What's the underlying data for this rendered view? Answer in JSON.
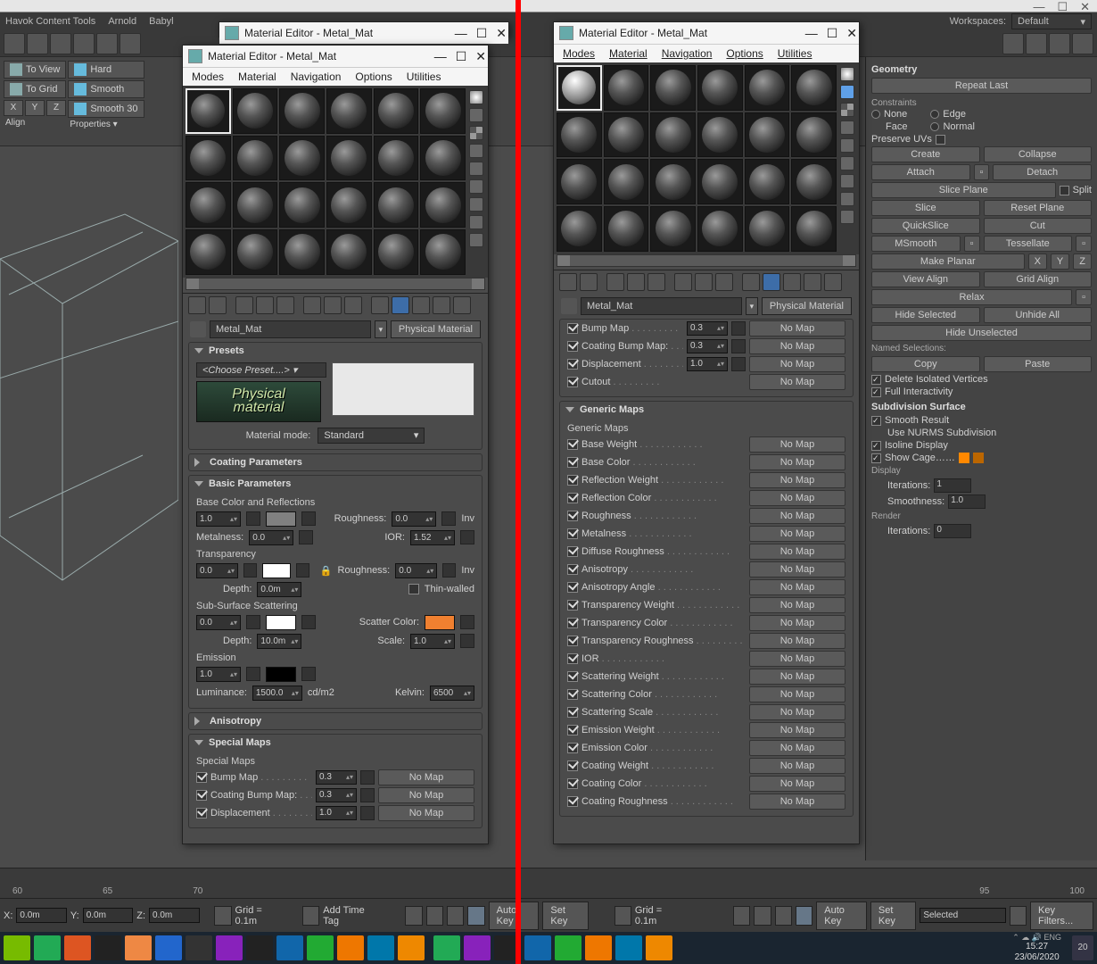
{
  "app": {
    "titlebar_ctrls": [
      "—",
      "☐",
      "✕"
    ]
  },
  "topmenu": {
    "left": [
      "Havok Content Tools",
      "Arnold",
      "Babyl"
    ],
    "right_workspaces_label": "Workspaces:",
    "right_workspaces_value": "Default"
  },
  "ribbon": {
    "to_view": "To View",
    "to_grid": "To Grid",
    "align": "Align",
    "hard": "Hard",
    "smooth": "Smooth",
    "smooth30": "Smooth 30",
    "properties": "Properties ▾",
    "x": "X",
    "y": "Y",
    "z": "Z"
  },
  "mat_editor": {
    "title": "Material Editor - Metal_Mat",
    "menu": [
      "Modes",
      "Material",
      "Navigation",
      "Options",
      "Utilities"
    ],
    "name": "Metal_Mat",
    "type_btn": "Physical Material",
    "presets_h": "Presets",
    "preset_choose": "<Choose Preset....>",
    "phys_logo_line1": "Physical",
    "phys_logo_line2": "material",
    "material_mode_label": "Material mode:",
    "material_mode_value": "Standard",
    "coating_h": "Coating Parameters",
    "basic_h": "Basic Parameters",
    "base_color_h": "Base Color and Reflections",
    "roughness_label": "Roughness:",
    "inv_label": "Inv",
    "metalness_label": "Metalness:",
    "ior_label": "IOR:",
    "trans_h": "Transparency",
    "depth_label": "Depth:",
    "thin_label": "Thin-walled",
    "sss_h": "Sub-Surface Scattering",
    "scatter_color_label": "Scatter Color:",
    "scale_label": "Scale:",
    "emission_h": "Emission",
    "luminance_label": "Luminance:",
    "luminance_unit": "cd/m2",
    "kelvin_label": "Kelvin:",
    "aniso_h": "Anisotropy",
    "special_h": "Special Maps",
    "special_sub": "Special Maps",
    "generic_h": "Generic Maps",
    "generic_sub": "Generic Maps",
    "nomap": "No Map",
    "vals": {
      "base_weight": "1.0",
      "roughness": "0.0",
      "metalness": "0.0",
      "ior": "1.52",
      "trans": "0.0",
      "trans_rough": "0.0",
      "trans_depth": "0.0m",
      "sss": "0.0",
      "sss_depth": "10.0m",
      "sss_scale": "1.0",
      "emit": "1.0",
      "luminance": "1500.0",
      "kelvin": "6500"
    },
    "special_maps": [
      {
        "label": "Bump Map",
        "val": "0.3",
        "has_val": true
      },
      {
        "label": "Coating Bump Map:",
        "val": "0.3",
        "has_val": true
      },
      {
        "label": "Displacement",
        "val": "1.0",
        "has_val": true
      },
      {
        "label": "Cutout",
        "val": "",
        "has_val": false
      }
    ],
    "generic_maps": [
      "Base Weight",
      "Base Color",
      "Reflection Weight",
      "Reflection Color",
      "Roughness",
      "Metalness",
      "Diffuse Roughness",
      "Anisotropy",
      "Anisotropy Angle",
      "Transparency Weight",
      "Transparency Color",
      "Transparency Roughness",
      "IOR",
      "Scattering Weight",
      "Scattering Color",
      "Scattering Scale",
      "Emission Weight",
      "Emission Color",
      "Coating Weight",
      "Coating Color",
      "Coating Roughness"
    ]
  },
  "rightpanel": {
    "geometry": "Geometry",
    "repeat_last": "Repeat Last",
    "constraints": "Constraints",
    "none": "None",
    "edge": "Edge",
    "face": "Face",
    "normal": "Normal",
    "preserve_uvs": "Preserve UVs",
    "create": "Create",
    "collapse": "Collapse",
    "attach": "Attach",
    "detach": "Detach",
    "slice_plane": "Slice Plane",
    "split": "Split",
    "slice": "Slice",
    "reset_plane": "Reset Plane",
    "quickslice": "QuickSlice",
    "cut": "Cut",
    "msmooth": "MSmooth",
    "tessellate": "Tessellate",
    "make_planar": "Make Planar",
    "view_align": "View Align",
    "grid_align": "Grid Align",
    "relax": "Relax",
    "hide_selected": "Hide Selected",
    "unhide_all": "Unhide All",
    "hide_unselected": "Hide Unselected",
    "named_selections": "Named Selections:",
    "copy": "Copy",
    "paste": "Paste",
    "delete_iso": "Delete Isolated Vertices",
    "full_inter": "Full Interactivity",
    "div_surf": "Subdivision Surface",
    "smooth_result": "Smooth Result",
    "nurms": "Use NURMS Subdivision",
    "isoline": "Isoline Display",
    "show_cage": "Show Cage……",
    "display": "Display",
    "iterations": "Iterations:",
    "iterations_val": "1",
    "smoothness": "Smoothness:",
    "smoothness_val": "1.0",
    "render": "Render",
    "render_iter_val": "0"
  },
  "status": {
    "x_lbl": "X:",
    "x_val": "0.0m",
    "y_lbl": "Y:",
    "y_val": "0.0m",
    "z_lbl": "Z:",
    "z_val": "0.0m",
    "grid": "Grid = 0.1m",
    "add_time_tag": "Add Time Tag",
    "auto_key": "Auto Key",
    "set_key": "Set Key",
    "selected": "Selected",
    "key_filters": "Key Filters...",
    "lang": "ENG",
    "time": "15:27",
    "date": "23/06/2020",
    "notif": "20"
  },
  "timeline": {
    "left_ticks": [
      "60",
      "65",
      "70"
    ],
    "right_ticks": [
      "95",
      "100"
    ]
  }
}
